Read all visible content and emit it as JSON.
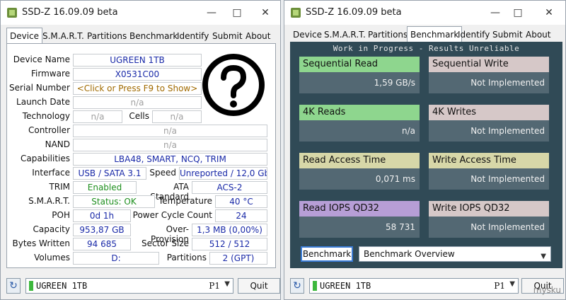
{
  "left": {
    "title": "SSD-Z 16.09.09 beta",
    "tabs": [
      "Device",
      "S.M.A.R.T.",
      "Partitions",
      "Benchmark",
      "Identify",
      "Submit",
      "About"
    ],
    "fields": {
      "device_name_label": "Device Name",
      "device_name": "UGREEN 1TB",
      "firmware_label": "Firmware",
      "firmware": "X0531C00",
      "serial_label": "Serial Number",
      "serial": "<Click or Press F9 to Show>",
      "launch_label": "Launch Date",
      "launch": "n/a",
      "technology_label": "Technology",
      "technology": "n/a",
      "cells_label": "Cells",
      "cells": "n/a",
      "controller_label": "Controller",
      "controller": "n/a",
      "nand_label": "NAND",
      "nand": "n/a",
      "capabilities_label": "Capabilities",
      "capabilities": "LBA48, SMART, NCQ, TRIM",
      "interface_label": "Interface",
      "interface": "USB / SATA 3.1",
      "speed_label": "Speed",
      "speed": "Unreported / 12,0 Gbps",
      "trim_label": "TRIM",
      "trim": "Enabled",
      "ata_label": "ATA Standard",
      "ata": "ACS-2",
      "smart_label": "S.M.A.R.T.",
      "smart": "Status: OK",
      "temperature_label": "Temperature",
      "temperature": "40 °C",
      "poh_label": "POH",
      "poh": "0d 1h",
      "power_cycle_label": "Power Cycle Count",
      "power_cycle": "24",
      "capacity_label": "Capacity",
      "capacity": "953,87 GB",
      "over_prov_label": "Over-Provision",
      "over_prov": "1,3 MB (0,00%)",
      "bytes_written_label": "Bytes Written",
      "bytes_written": "94 685",
      "sector_label": "Sector Size",
      "sector": "512 / 512",
      "volumes_label": "Volumes",
      "volumes": "D:",
      "partitions_label": "Partitions",
      "partitions": "2 (GPT)"
    },
    "drive": "UGREEN 1TB",
    "port": "P1",
    "quit": "Quit"
  },
  "right": {
    "title": "SSD-Z 16.09.09 beta",
    "tabs": [
      "Device",
      "S.M.A.R.T.",
      "Partitions",
      "Benchmark",
      "Identify",
      "Submit",
      "About"
    ],
    "status": "Work in Progress - Results Unreliable",
    "cards": [
      {
        "label": "Sequential Read",
        "value": "1,59 GB/s"
      },
      {
        "label": "Sequential Write",
        "value": "Not Implemented"
      },
      {
        "label": "4K Reads",
        "value": "n/a"
      },
      {
        "label": "4K Writes",
        "value": "Not Implemented"
      },
      {
        "label": "Read Access Time",
        "value": "0,071 ms"
      },
      {
        "label": "Write Access Time",
        "value": "Not Implemented"
      },
      {
        "label": "Read IOPS QD32",
        "value": "58 731"
      },
      {
        "label": "Write IOPS QD32",
        "value": "Not Implemented"
      }
    ],
    "benchmark_button": "Benchmark",
    "benchmark_select": "Benchmark Overview",
    "drive": "UGREEN 1TB",
    "port": "P1",
    "quit": "Quit",
    "watermark": "mysku"
  }
}
